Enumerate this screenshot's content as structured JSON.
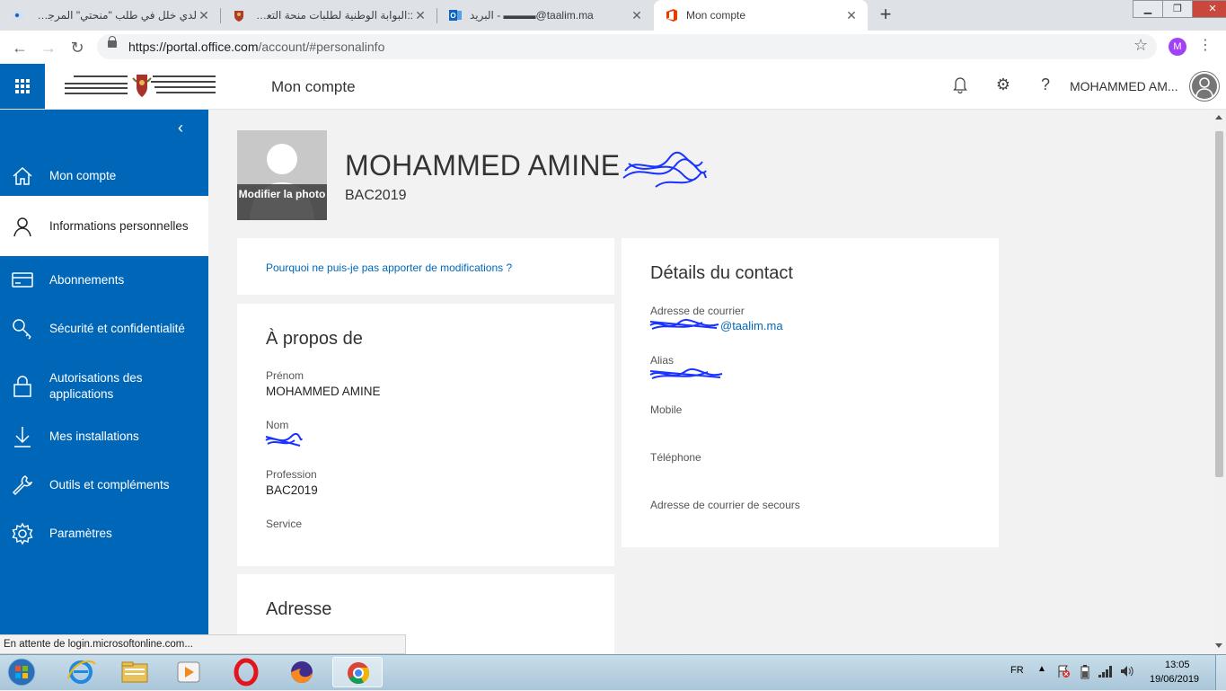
{
  "browser": {
    "tabs": [
      {
        "title": "لدي خلل في طلب \"منحتي\" المرجو مساعدتي",
        "active": false
      },
      {
        "title": "::البوابة الوطنية لطلبات منحة التعليم العالي",
        "active": false
      },
      {
        "title": "البريد - ▬▬▬@taalim.ma",
        "active": false
      },
      {
        "title": "Mon compte",
        "active": true
      }
    ],
    "url_host": "https://portal.office.com",
    "url_path": "/account/#personalinfo",
    "profile_initial": "M",
    "status_text": "En attente de login.microsoftonline.com..."
  },
  "header": {
    "app_title": "Mon compte",
    "user_name": "MOHAMMED AM..."
  },
  "nav": {
    "items": [
      {
        "label": "Mon compte",
        "icon": "home-icon",
        "selected": false
      },
      {
        "label": "Informations personnelles",
        "icon": "person-icon",
        "selected": true
      },
      {
        "label": "Abonnements",
        "icon": "card-icon",
        "selected": false
      },
      {
        "label": "Sécurité et confidentialité",
        "icon": "key-search-icon",
        "selected": false
      },
      {
        "label": "Autorisations des applications",
        "icon": "lock-icon",
        "selected": false
      },
      {
        "label": "Mes installations",
        "icon": "download-icon",
        "selected": false
      },
      {
        "label": "Outils et compléments",
        "icon": "wrench-icon",
        "selected": false
      },
      {
        "label": "Paramètres",
        "icon": "gear-icon",
        "selected": false
      }
    ]
  },
  "profile": {
    "photo_edit_label": "Modifier la photo",
    "full_name": "MOHAMMED AMINE",
    "subtitle": "BAC2019"
  },
  "notice": {
    "link": "Pourquoi ne puis-je pas apporter de modifications ?"
  },
  "about": {
    "title": "À propos de",
    "first_name_label": "Prénom",
    "first_name_value": "MOHAMMED AMINE",
    "last_name_label": "Nom",
    "profession_label": "Profession",
    "profession_value": "BAC2019",
    "service_label": "Service"
  },
  "address": {
    "title": "Adresse"
  },
  "contact": {
    "title": "Détails du contact",
    "email_label": "Adresse de courrier",
    "email_value": "@taalim.ma",
    "alias_label": "Alias",
    "mobile_label": "Mobile",
    "phone_label": "Téléphone",
    "backup_email_label": "Adresse de courrier de secours"
  },
  "taskbar": {
    "language": "FR",
    "time": "13:05",
    "date": "19/06/2019"
  },
  "colors": {
    "office_blue": "#0067b8",
    "redaction_ink": "#1a33ff"
  }
}
